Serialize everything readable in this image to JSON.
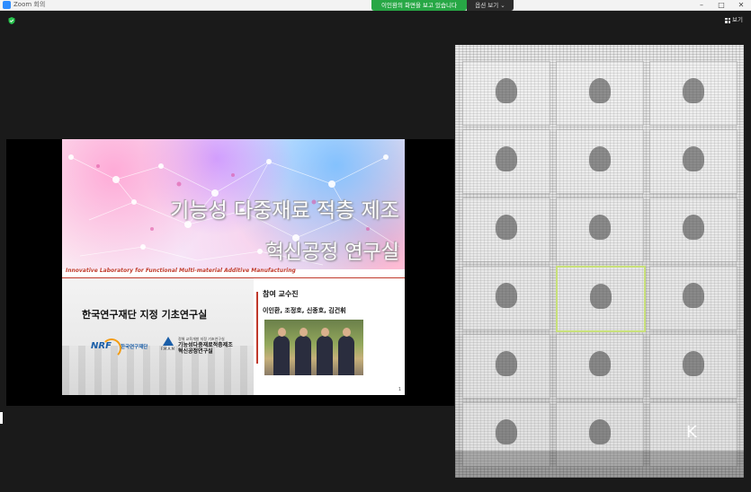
{
  "window": {
    "title": "Zoom 회의",
    "controls": [
      "–",
      "□",
      "✕"
    ]
  },
  "share_banner": {
    "text": "이인환의 화면을 보고 있습니다",
    "view_options": "옵션 보기 ⌄"
  },
  "toolbar": {
    "view_label": "보기"
  },
  "slide": {
    "title_line1": "기능성 다중재료 적층 제조",
    "title_line2": "혁신공정 연구실",
    "subtitle": "Innovative Laboratory for Functional Multi-material Additive Manufacturing",
    "institution_heading": "한국연구재단 지정 기초연구실",
    "nrf_logo_text": "NRF",
    "nrf_name": "한국연구재단",
    "fmam_small": "정해 교육개발 지정 기초연구실",
    "fmam_line1": "기능성다중재료적층제조",
    "fmam_line2": "혁신공정연구실",
    "fmam_mark_label": "F.M.A.M",
    "professor_label": "참여 교수진",
    "professor_names": "이인환, 조정호, 신종호, 김건휘",
    "page_number": "1"
  },
  "gallery": {
    "tiles": [
      {
        "name": ""
      },
      {
        "name": ""
      },
      {
        "name": ""
      },
      {
        "name": ""
      },
      {
        "name": ""
      },
      {
        "name": ""
      },
      {
        "name": ""
      },
      {
        "name": ""
      },
      {
        "name": ""
      },
      {
        "name": ""
      },
      {
        "name": ""
      },
      {
        "name": ""
      },
      {
        "name": ""
      },
      {
        "name": ""
      },
      {
        "name": ""
      },
      {
        "name": ""
      },
      {
        "name": ""
      },
      {
        "name": "K"
      }
    ]
  },
  "colors": {
    "share_banner_bg": "#27a745",
    "accent_red": "#c0392b",
    "zoom_blue": "#2d8cff"
  }
}
